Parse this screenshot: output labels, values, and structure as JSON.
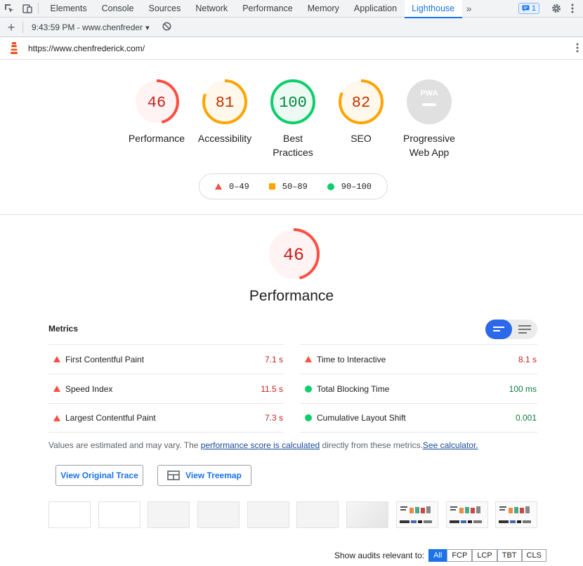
{
  "devtools": {
    "tabs": [
      "Elements",
      "Console",
      "Sources",
      "Network",
      "Performance",
      "Memory",
      "Application",
      "Lighthouse"
    ],
    "active_tab": "Lighthouse",
    "more_tabs": "»",
    "issues_count": "1"
  },
  "toolbar": {
    "add_label": "+",
    "report_time": "9:43:59 PM - www.chenfreder",
    "dropdown_arrow": "▾"
  },
  "url": "https://www.chenfrederick.com/",
  "categories": [
    {
      "score": "46",
      "label": "Performance",
      "color": "#ff4e42"
    },
    {
      "score": "81",
      "label": "Accessibility",
      "color": "#ffa400"
    },
    {
      "score": "100",
      "label": "Best Practices",
      "color": "#0cce6b"
    },
    {
      "score": "82",
      "label": "SEO",
      "color": "#ffa400"
    },
    {
      "score": "",
      "label": "Progressive Web App",
      "color": "#e0e0e0"
    }
  ],
  "category_labels": {
    "perf": "Performance",
    "a11y": "Accessibility",
    "bp_line1": "Best",
    "bp_line2": "Practices",
    "seo": "SEO",
    "pwa_line1": "Progressive",
    "pwa_line2": "Web App",
    "pwa_badge": "PWA"
  },
  "legend": {
    "fail": "0–49",
    "average": "50–89",
    "pass": "90–100"
  },
  "performance": {
    "score": "46",
    "title": "Performance",
    "metrics_heading": "Metrics",
    "metrics": [
      {
        "name": "First Contentful Paint",
        "value": "7.1 s",
        "status": "fail"
      },
      {
        "name": "Speed Index",
        "value": "11.5 s",
        "status": "fail"
      },
      {
        "name": "Largest Contentful Paint",
        "value": "7.3 s",
        "status": "fail"
      },
      {
        "name": "Time to Interactive",
        "value": "8.1 s",
        "status": "fail"
      },
      {
        "name": "Total Blocking Time",
        "value": "100 ms",
        "status": "pass"
      },
      {
        "name": "Cumulative Layout Shift",
        "value": "0.001",
        "status": "pass"
      }
    ],
    "note_prefix": "Values are estimated and may vary. The ",
    "note_link": "performance score is calculated",
    "note_middle": " directly from these metrics.",
    "note_calc_link": "See calculator.",
    "view_trace": "View Original Trace",
    "view_treemap": "View Treemap"
  },
  "audit_filter": {
    "label": "Show audits relevant to:",
    "chips": [
      "All",
      "FCP",
      "LCP",
      "TBT",
      "CLS"
    ],
    "active": "All"
  },
  "colors": {
    "fail": "#ff4e42",
    "average": "#ffa400",
    "pass": "#0cce6b",
    "accent": "#1a73e8"
  }
}
